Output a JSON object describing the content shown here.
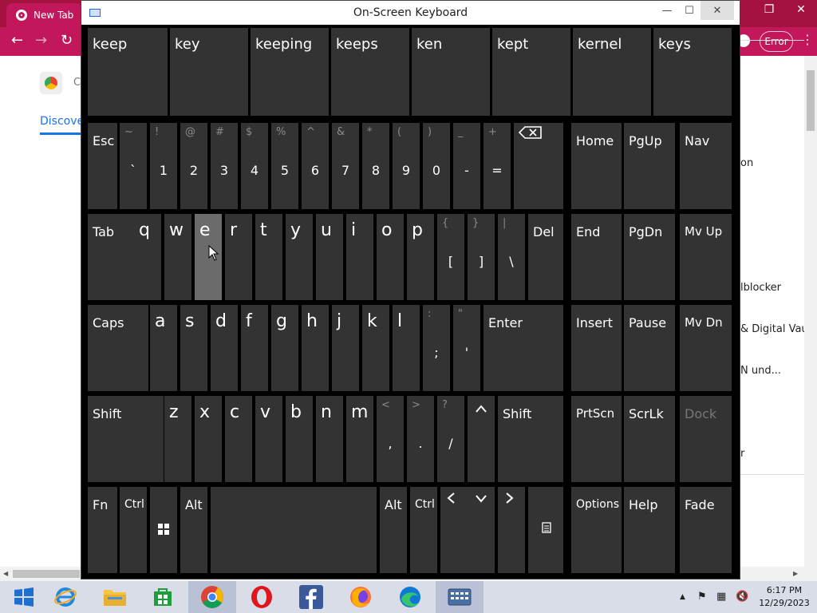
{
  "browser": {
    "tab_title": "New Tab",
    "error_label": "Error",
    "discover_label": "Discove",
    "partial_c": "C",
    "side_texts": [
      "on",
      "lblocker",
      "& Digital Vaul",
      "N und...",
      "r"
    ]
  },
  "osk": {
    "title": "On-Screen Keyboard",
    "minimize": "—",
    "maximize": "☐",
    "close": "✕",
    "predictions": [
      "keep",
      "key",
      "keeping",
      "keeps",
      "ken",
      "kept",
      "kernel",
      "keys"
    ],
    "row1": {
      "esc": "Esc",
      "keys": [
        {
          "top": "~",
          "main": "`"
        },
        {
          "top": "!",
          "main": "1"
        },
        {
          "top": "@",
          "main": "2"
        },
        {
          "top": "#",
          "main": "3"
        },
        {
          "top": "$",
          "main": "4"
        },
        {
          "top": "%",
          "main": "5"
        },
        {
          "top": "^",
          "main": "6"
        },
        {
          "top": "&",
          "main": "7"
        },
        {
          "top": "*",
          "main": "8"
        },
        {
          "top": "(",
          "main": "9"
        },
        {
          "top": ")",
          "main": "0"
        },
        {
          "top": "_",
          "main": "-"
        },
        {
          "top": "+",
          "main": "="
        }
      ],
      "backspace_icon": "backspace-icon",
      "home": "Home",
      "pgup": "PgUp",
      "nav": "Nav"
    },
    "row2": {
      "tab": "Tab",
      "letters": [
        "q",
        "w",
        "e",
        "r",
        "t",
        "y",
        "u",
        "i",
        "o",
        "p"
      ],
      "brackets": [
        {
          "top": "{",
          "main": "["
        },
        {
          "top": "}",
          "main": "]"
        },
        {
          "top": "|",
          "main": "\\"
        }
      ],
      "del": "Del",
      "end": "End",
      "pgdn": "PgDn",
      "mvup": "Mv Up"
    },
    "row3": {
      "caps": "Caps",
      "letters": [
        "a",
        "s",
        "d",
        "f",
        "g",
        "h",
        "j",
        "k",
        "l"
      ],
      "punct": [
        {
          "top": ":",
          "main": ";"
        },
        {
          "top": "\"",
          "main": "'"
        }
      ],
      "enter": "Enter",
      "insert": "Insert",
      "pause": "Pause",
      "mvdn": "Mv Dn"
    },
    "row4": {
      "shift_left": "Shift",
      "letters": [
        "z",
        "x",
        "c",
        "v",
        "b",
        "n",
        "m"
      ],
      "punct": [
        {
          "top": "<",
          "main": ","
        },
        {
          "top": ">",
          "main": "."
        },
        {
          "top": "?",
          "main": "/"
        }
      ],
      "up_arrow": "^",
      "shift_right": "Shift",
      "prtscn": "PrtScn",
      "scrlk": "ScrLk",
      "dock": "Dock"
    },
    "row5": {
      "fn": "Fn",
      "ctrl_left": "Ctrl",
      "alt_left": "Alt",
      "alt_right": "Alt",
      "ctrl_right": "Ctrl",
      "left_arrow": "<",
      "down_arrow": "v",
      "right_arrow": ">",
      "options": "Options",
      "help": "Help",
      "fade": "Fade"
    }
  },
  "taskbar": {
    "time": "6:17 PM",
    "date": "12/29/2023",
    "apps": [
      "start-icon",
      "internet-explorer-icon",
      "file-explorer-icon",
      "store-icon",
      "chrome-icon",
      "opera-icon",
      "facebook-icon",
      "firefox-icon",
      "edge-icon",
      "on-screen-keyboard-icon"
    ]
  }
}
